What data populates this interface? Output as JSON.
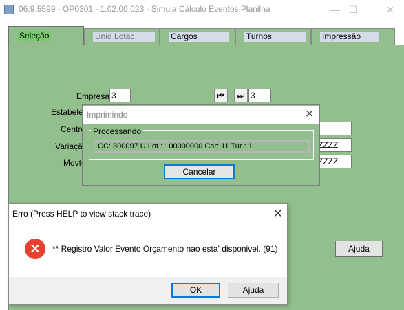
{
  "window": {
    "title": "06.9.5599 - OP0301 - 1.02.00.023 - Simula Cálculo Eventos Planilha",
    "minimize": "—",
    "maximize": "☐",
    "close": "✕"
  },
  "tabs": [
    {
      "label": "Seleção",
      "state": "selected"
    },
    {
      "label": "Unid Lotac",
      "state": "disabled"
    },
    {
      "label": "Cargos",
      "state": "normal"
    },
    {
      "label": "Turnos",
      "state": "normal"
    },
    {
      "label": "Impressão",
      "state": "normal"
    }
  ],
  "form": {
    "empresa_label": "Empresa:",
    "empresa_value": "3",
    "nav_first": "⏮",
    "nav_last": "⏭",
    "nav_value": "3",
    "estabelec_label": "Estabelec",
    "centro_label": "Centro",
    "variacao_label": "Variação",
    "variacao_value": "ZZZZ",
    "movto_label": "Movto",
    "movto_value": "ZZZZ"
  },
  "side_help_button": "Ajuda",
  "print_dialog": {
    "title": "Imprimindo",
    "group_label": "Processando",
    "status_text": "CC: 300097 U Lot : 100000000 Car: 11 Tur : 1",
    "cancel_label": "Cancelar"
  },
  "error_dialog": {
    "title": "Erro (Press HELP to view stack trace)",
    "icon": "error-x-icon",
    "message": "** Registro Valor Evento Orçamento nao esta' disponivel. (91)",
    "ok_label": "OK",
    "help_label": "Ajuda"
  },
  "colors": {
    "panel_green": "#93bf8e",
    "selected_tab": "#79c96f",
    "error_red": "#e8412f",
    "focus_blue": "#0f78d7"
  }
}
